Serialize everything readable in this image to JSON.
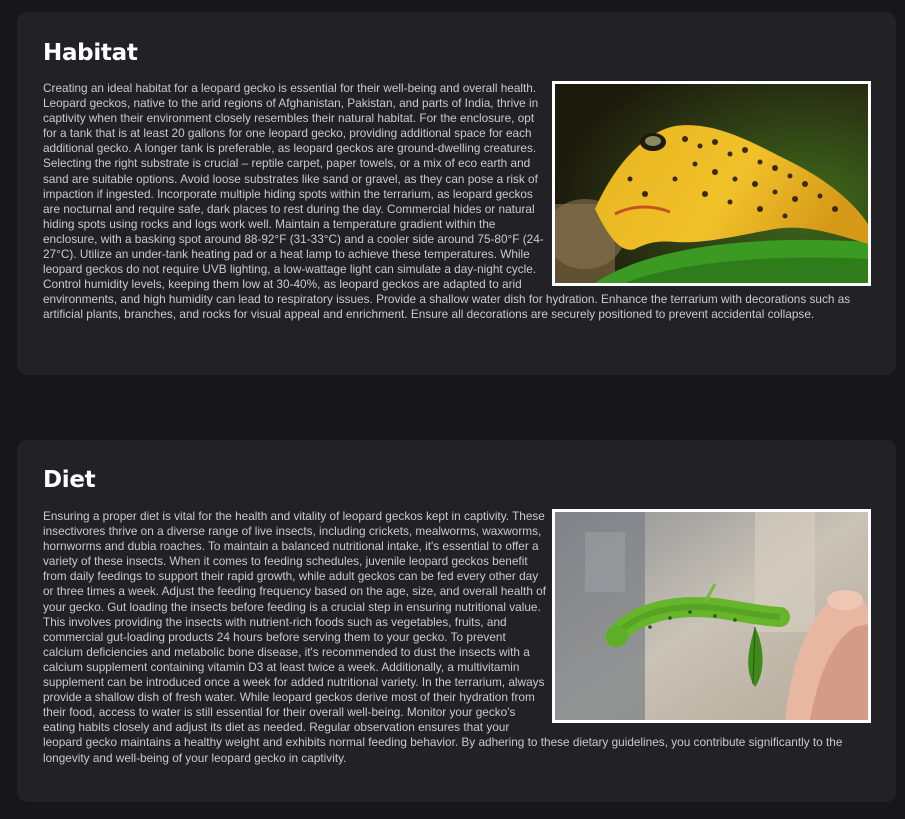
{
  "habitat": {
    "title": "Habitat",
    "text": "Creating an ideal habitat for a leopard gecko is essential for their well-being and overall health. Leopard geckos, native to the arid regions of Afghanistan, Pakistan, and parts of India, thrive in captivity when their environment closely resembles their natural habitat. For the enclosure, opt for a tank that is at least 20 gallons for one leopard gecko, providing additional space for each additional gecko. A longer tank is preferable, as leopard geckos are ground-dwelling creatures. Selecting the right substrate is crucial – reptile carpet, paper towels, or a mix of eco earth and sand are suitable options. Avoid loose substrates like sand or gravel, as they can pose a risk of impaction if ingested. Incorporate multiple hiding spots within the terrarium, as leopard geckos are nocturnal and require safe, dark places to rest during the day. Commercial hides or natural hiding spots using rocks and logs work well. Maintain a temperature gradient within the enclosure, with a basking spot around 88-92°F (31-33°C) and a cooler side around 75-80°F (24-27°C). Utilize an under-tank heating pad or a heat lamp to achieve these temperatures. While leopard geckos do not require UVB lighting, a low-wattage light can simulate a day-night cycle. Control humidity levels, keeping them low at 30-40%, as leopard geckos are adapted to arid environments, and high humidity can lead to respiratory issues. Provide a shallow water dish for hydration. Enhance the terrarium with decorations such as artificial plants, branches, and rocks for visual appeal and enrichment. Ensure all decorations are securely positioned to prevent accidental collapse."
  },
  "diet": {
    "title": "Diet",
    "text": "Ensuring a proper diet is vital for the health and vitality of leopard geckos kept in captivity. These insectivores thrive on a diverse range of live insects, including crickets, mealworms, waxworms, hornworms and dubia roaches. To maintain a balanced nutritional intake, it's essential to offer a variety of these insects. When it comes to feeding schedules, juvenile leopard geckos benefit from daily feedings to support their rapid growth, while adult geckos can be fed every other day or three times a week. Adjust the feeding frequency based on the age, size, and overall health of your gecko. Gut loading the insects before feeding is a crucial step in ensuring nutritional value. This involves providing the insects with nutrient-rich foods such as vegetables, fruits, and commercial gut-loading products 24 hours before serving them to your gecko. To prevent calcium deficiencies and metabolic bone disease, it's recommended to dust the insects with a calcium supplement containing vitamin D3 at least twice a week. Additionally, a multivitamin supplement can be introduced once a week for added nutritional variety. In the terrarium, always provide a shallow dish of fresh water. While leopard geckos derive most of their hydration from their food, access to water is still essential for their overall well-being. Monitor your gecko's eating habits closely and adjust its diet as needed. Regular observation ensures that your leopard gecko maintains a healthy weight and exhibits normal feeding behavior. By adhering to these dietary guidelines, you contribute significantly to the longevity and well-being of your leopard gecko in captivity."
  }
}
